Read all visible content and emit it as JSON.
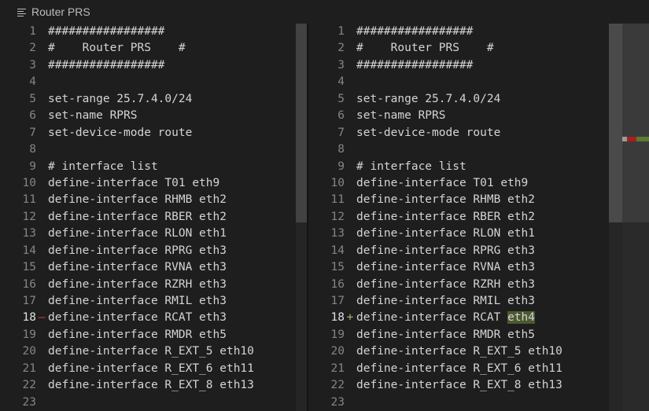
{
  "breadcrumb": {
    "icon": "menu-lines-icon",
    "title": "Router PRS"
  },
  "left": {
    "lines": [
      {
        "num": "1",
        "text": "#################"
      },
      {
        "num": "2",
        "text": "#    Router PRS    #"
      },
      {
        "num": "3",
        "text": "#################"
      },
      {
        "num": "4",
        "text": ""
      },
      {
        "num": "5",
        "text": "set-range 25.7.4.0/24"
      },
      {
        "num": "6",
        "text": "set-name RPRS"
      },
      {
        "num": "7",
        "text": "set-device-mode route"
      },
      {
        "num": "8",
        "text": ""
      },
      {
        "num": "9",
        "text": "# interface list"
      },
      {
        "num": "10",
        "text": "define-interface T01 eth9"
      },
      {
        "num": "11",
        "text": "define-interface RHMB eth2"
      },
      {
        "num": "12",
        "text": "define-interface RBER eth2"
      },
      {
        "num": "13",
        "text": "define-interface RLON eth1"
      },
      {
        "num": "14",
        "text": "define-interface RPRG eth3"
      },
      {
        "num": "15",
        "text": "define-interface RVNA eth3"
      },
      {
        "num": "16",
        "text": "define-interface RZRH eth3"
      },
      {
        "num": "17",
        "text": "define-interface RMIL eth3"
      },
      {
        "num": "18",
        "text": "define-interface RCAT eth3",
        "marker": "—",
        "type": "deleted"
      },
      {
        "num": "19",
        "text": "define-interface RMDR eth5"
      },
      {
        "num": "20",
        "text": "define-interface R_EXT_5 eth10"
      },
      {
        "num": "21",
        "text": "define-interface R_EXT_6 eth11"
      },
      {
        "num": "22",
        "text": "define-interface R_EXT_8 eth13"
      },
      {
        "num": "23",
        "text": ""
      }
    ]
  },
  "right": {
    "lines": [
      {
        "num": "1",
        "text": "#################"
      },
      {
        "num": "2",
        "text": "#    Router PRS    #"
      },
      {
        "num": "3",
        "text": "#################"
      },
      {
        "num": "4",
        "text": ""
      },
      {
        "num": "5",
        "text": "set-range 25.7.4.0/24"
      },
      {
        "num": "6",
        "text": "set-name RPRS"
      },
      {
        "num": "7",
        "text": "set-device-mode route"
      },
      {
        "num": "8",
        "text": ""
      },
      {
        "num": "9",
        "text": "# interface list"
      },
      {
        "num": "10",
        "text": "define-interface T01 eth9"
      },
      {
        "num": "11",
        "text": "define-interface RHMB eth2"
      },
      {
        "num": "12",
        "text": "define-interface RBER eth2"
      },
      {
        "num": "13",
        "text": "define-interface RLON eth1"
      },
      {
        "num": "14",
        "text": "define-interface RPRG eth3"
      },
      {
        "num": "15",
        "text": "define-interface RVNA eth3"
      },
      {
        "num": "16",
        "text": "define-interface RZRH eth3"
      },
      {
        "num": "17",
        "text": "define-interface RMIL eth3"
      },
      {
        "num": "18",
        "text_before": "define-interface RCAT ",
        "text_changed": "eth4",
        "marker": "+",
        "type": "inserted"
      },
      {
        "num": "19",
        "text": "define-interface RMDR eth5"
      },
      {
        "num": "20",
        "text": "define-interface R_EXT_5 eth10"
      },
      {
        "num": "21",
        "text": "define-interface R_EXT_6 eth11"
      },
      {
        "num": "22",
        "text": "define-interface R_EXT_8 eth13"
      },
      {
        "num": "23",
        "text": ""
      }
    ]
  },
  "colors": {
    "editor_bg": "#1e1e1e",
    "deleted_line": "#4b1818",
    "inserted_line": "#373d29",
    "inserted_word": "#4b5a2f",
    "line_number": "#858585"
  }
}
